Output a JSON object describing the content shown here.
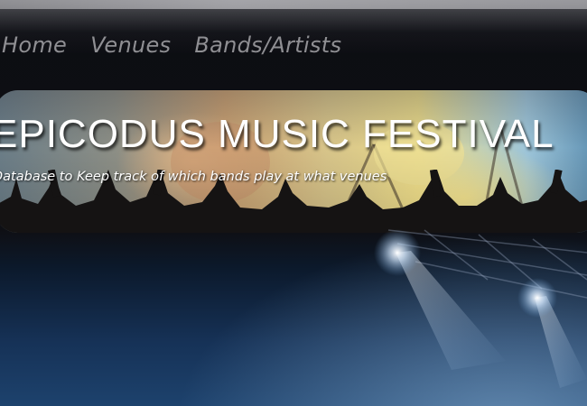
{
  "nav": {
    "items": [
      {
        "label": "Home"
      },
      {
        "label": "Venues"
      },
      {
        "label": "Bands/Artists"
      }
    ]
  },
  "banner": {
    "title": "EPICODUS MUSIC FESTIVAL",
    "subtitle": "Database to Keep track of which bands play at what venues"
  }
}
